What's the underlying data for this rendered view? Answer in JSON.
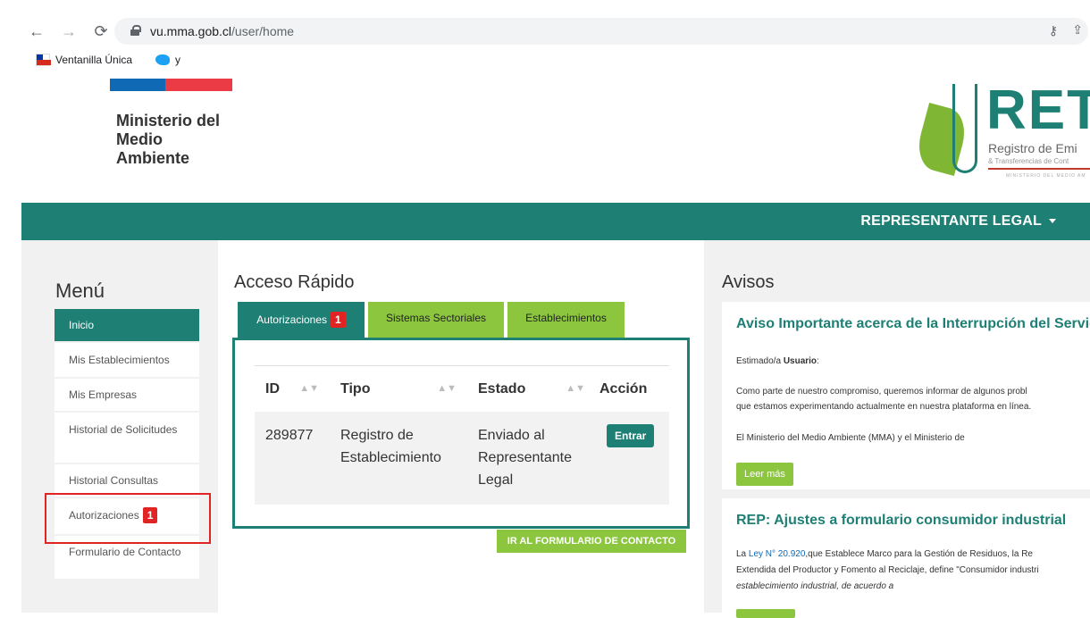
{
  "browser": {
    "url_host": "vu.mma.gob.cl",
    "url_path": "/user/home",
    "bookmarks": [
      "Ventanilla Única",
      "y"
    ]
  },
  "header": {
    "ministry": [
      "Ministerio del",
      "Medio",
      "Ambiente"
    ],
    "logo_text": "RET",
    "logo_sub": "Registro de Emi",
    "logo_sub2": "& Transferencias de Cont",
    "logo_sub3": "MINISTERIO DEL MEDIO AM"
  },
  "topbar": {
    "role": "REPRESENTANTE LEGAL"
  },
  "menu": {
    "title": "Menú",
    "items": [
      {
        "label": "Inicio"
      },
      {
        "label": "Mis Establecimientos"
      },
      {
        "label": "Mis Empresas"
      },
      {
        "label": "Historial de Solicitudes"
      },
      {
        "label": "Historial Consultas"
      },
      {
        "label": "Autorizaciones",
        "badge": "1"
      },
      {
        "label": "Formulario de Contacto"
      }
    ]
  },
  "quick_access": {
    "title": "Acceso Rápido",
    "tabs": [
      {
        "label": "Autorizaciones",
        "badge": "1"
      },
      {
        "label": "Sistemas Sectoriales"
      },
      {
        "label": "Establecimientos"
      }
    ],
    "table": {
      "headers": [
        "ID",
        "Tipo",
        "Estado",
        "Acción"
      ],
      "rows": [
        {
          "id": "289877",
          "tipo": "Registro de Establecimiento",
          "estado": "Enviado al Representante Legal",
          "action": "Entrar"
        }
      ]
    },
    "contact_button": "IR AL FORMULARIO DE CONTACTO"
  },
  "avisos": {
    "title": "Avisos",
    "cards": [
      {
        "title": "Aviso Importante acerca de la Interrupción del Servic",
        "greeting_prefix": "Estimado/a ",
        "greeting_bold": "Usuario",
        "greeting_suffix": ":",
        "line1": "Como parte de nuestro compromiso, queremos informar de algunos probl",
        "line2": "que estamos experimentando actualmente en nuestra plataforma en línea.",
        "line3": "El Ministerio del Medio Ambiente (MMA) y el Ministerio de",
        "button": "Leer más"
      },
      {
        "title": "REP: Ajustes a formulario consumidor industrial",
        "line1_prefix": "La ",
        "line1_link": "Ley N° 20.920",
        "line1_suffix": ",que Establece Marco para la Gestión de Residuos, la Re",
        "line2": "Extendida del Productor y Fomento al Reciclaje, define \"Consumidor industri",
        "line3": "establecimiento industrial, de acuerdo a"
      }
    ]
  },
  "colors": {
    "primary": "#1e7f74",
    "accent": "#8cc63f",
    "badge": "#e02424"
  }
}
